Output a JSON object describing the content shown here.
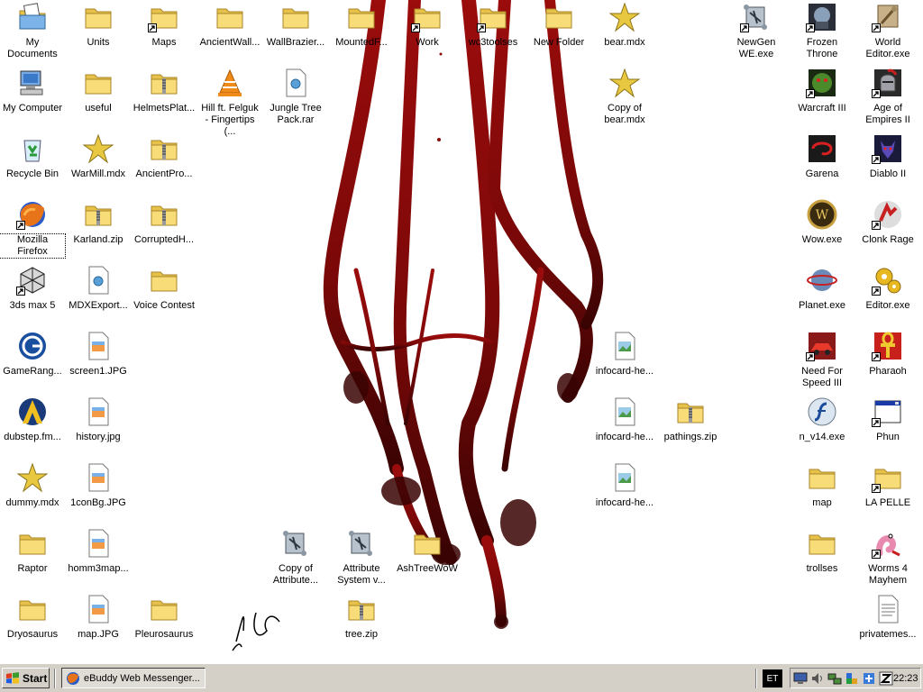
{
  "desktop": {
    "icons": [
      {
        "id": "my-documents",
        "label": "My Documents",
        "type": "mydocs",
        "shortcut": false,
        "col": 0,
        "row": 0
      },
      {
        "id": "units",
        "label": "Units",
        "type": "folder",
        "shortcut": false,
        "col": 1,
        "row": 0
      },
      {
        "id": "maps",
        "label": "Maps",
        "type": "folder",
        "shortcut": true,
        "col": 2,
        "row": 0
      },
      {
        "id": "ancientwall",
        "label": "AncientWall...",
        "type": "folder",
        "shortcut": false,
        "col": 3,
        "row": 0
      },
      {
        "id": "wallbrazier",
        "label": "WallBrazier...",
        "type": "folder",
        "shortcut": false,
        "col": 4,
        "row": 0
      },
      {
        "id": "mountedf",
        "label": "MountedF...",
        "type": "folder",
        "shortcut": false,
        "col": 5,
        "row": 0
      },
      {
        "id": "work",
        "label": "Work",
        "type": "folder",
        "shortcut": true,
        "col": 6,
        "row": 0
      },
      {
        "id": "wc3toolses",
        "label": "wc3toolses",
        "type": "folder",
        "shortcut": true,
        "col": 7,
        "row": 0
      },
      {
        "id": "new-folder",
        "label": "New Folder",
        "type": "folder",
        "shortcut": false,
        "col": 8,
        "row": 0
      },
      {
        "id": "bear-mdx",
        "label": "bear.mdx",
        "type": "star",
        "shortcut": false,
        "col": 9,
        "row": 0
      },
      {
        "id": "newgen-we",
        "label": "NewGen WE.exe",
        "type": "scroll",
        "shortcut": true,
        "col": 11,
        "row": 0
      },
      {
        "id": "frozen-throne",
        "label": "Frozen Throne",
        "type": "frozen",
        "shortcut": true,
        "col": 12,
        "row": 0
      },
      {
        "id": "world-editor",
        "label": "World Editor.exe",
        "type": "worldeditor",
        "shortcut": true,
        "col": 13,
        "row": 0
      },
      {
        "id": "my-computer",
        "label": "My Computer",
        "type": "computer",
        "shortcut": false,
        "col": 0,
        "row": 1
      },
      {
        "id": "useful",
        "label": "useful",
        "type": "folder",
        "shortcut": false,
        "col": 1,
        "row": 1
      },
      {
        "id": "helmetsplat",
        "label": "HelmetsPlat...",
        "type": "zip",
        "shortcut": false,
        "col": 2,
        "row": 1
      },
      {
        "id": "hill-felguk",
        "label": "Hill ft. Felguk - Fingertips (...",
        "type": "vlc",
        "shortcut": false,
        "col": 3,
        "row": 1
      },
      {
        "id": "jungle-tree",
        "label": "Jungle Tree Pack.rar",
        "type": "doc",
        "shortcut": false,
        "col": 4,
        "row": 1
      },
      {
        "id": "copy-bear",
        "label": "Copy of bear.mdx",
        "type": "star",
        "shortcut": false,
        "col": 9,
        "row": 1
      },
      {
        "id": "warcraft3",
        "label": "Warcraft III",
        "type": "orc",
        "shortcut": true,
        "col": 12,
        "row": 1
      },
      {
        "id": "aoe2",
        "label": "Age of Empires II",
        "type": "knight",
        "shortcut": true,
        "col": 13,
        "row": 1
      },
      {
        "id": "recycle-bin",
        "label": "Recycle Bin",
        "type": "recycle",
        "shortcut": false,
        "col": 0,
        "row": 2
      },
      {
        "id": "warmill",
        "label": "WarMill.mdx",
        "type": "star",
        "shortcut": false,
        "col": 1,
        "row": 2
      },
      {
        "id": "ancientpro",
        "label": "AncientPro...",
        "type": "zip",
        "shortcut": false,
        "col": 2,
        "row": 2
      },
      {
        "id": "garena",
        "label": "Garena",
        "type": "garena",
        "shortcut": false,
        "col": 12,
        "row": 2
      },
      {
        "id": "diablo2",
        "label": "Diablo II",
        "type": "diablo",
        "shortcut": true,
        "col": 13,
        "row": 2
      },
      {
        "id": "firefox",
        "label": "Mozilla Firefox",
        "type": "firefox",
        "shortcut": true,
        "col": 0,
        "row": 3,
        "selected": true
      },
      {
        "id": "karland",
        "label": "Karland.zip",
        "type": "zip",
        "shortcut": false,
        "col": 1,
        "row": 3
      },
      {
        "id": "corruptedh",
        "label": "CorruptedH...",
        "type": "zip",
        "shortcut": false,
        "col": 2,
        "row": 3
      },
      {
        "id": "wow",
        "label": "Wow.exe",
        "type": "wow",
        "shortcut": false,
        "col": 12,
        "row": 3
      },
      {
        "id": "clonk",
        "label": "Clonk Rage",
        "type": "clonk",
        "shortcut": true,
        "col": 13,
        "row": 3
      },
      {
        "id": "3dsmax",
        "label": "3ds max 5",
        "type": "max",
        "shortcut": true,
        "col": 0,
        "row": 4
      },
      {
        "id": "mdxexport",
        "label": "MDXExport...",
        "type": "doc",
        "shortcut": false,
        "col": 1,
        "row": 4
      },
      {
        "id": "voice-contest",
        "label": "Voice Contest",
        "type": "folder",
        "shortcut": false,
        "col": 2,
        "row": 4
      },
      {
        "id": "planet",
        "label": "Planet.exe",
        "type": "planet",
        "shortcut": false,
        "col": 12,
        "row": 4
      },
      {
        "id": "editor",
        "label": "Editor.exe",
        "type": "gears",
        "shortcut": true,
        "col": 13,
        "row": 4
      },
      {
        "id": "gameranger",
        "label": "GameRang...",
        "type": "gameranger",
        "shortcut": false,
        "col": 0,
        "row": 5
      },
      {
        "id": "screen1",
        "label": "screen1.JPG",
        "type": "jpg",
        "shortcut": false,
        "col": 1,
        "row": 5
      },
      {
        "id": "infocard1",
        "label": "infocard-he...",
        "type": "image",
        "shortcut": false,
        "col": 9,
        "row": 5
      },
      {
        "id": "nfs3",
        "label": "Need For Speed III",
        "type": "nfs",
        "shortcut": true,
        "col": 12,
        "row": 5
      },
      {
        "id": "pharaoh",
        "label": "Pharaoh",
        "type": "ankh",
        "shortcut": true,
        "col": 13,
        "row": 5
      },
      {
        "id": "dubstep",
        "label": "dubstep.fm...",
        "type": "dubstep",
        "shortcut": false,
        "col": 0,
        "row": 6
      },
      {
        "id": "history",
        "label": "history.jpg",
        "type": "jpg",
        "shortcut": false,
        "col": 1,
        "row": 6
      },
      {
        "id": "infocard2",
        "label": "infocard-he...",
        "type": "image",
        "shortcut": false,
        "col": 9,
        "row": 6
      },
      {
        "id": "pathings",
        "label": "pathings.zip",
        "type": "zip",
        "shortcut": false,
        "col": 10,
        "row": 6
      },
      {
        "id": "n-v14",
        "label": "n_v14.exe",
        "type": "flash",
        "shortcut": false,
        "col": 12,
        "row": 6
      },
      {
        "id": "phun",
        "label": "Phun",
        "type": "window",
        "shortcut": true,
        "col": 13,
        "row": 6
      },
      {
        "id": "dummy",
        "label": "dummy.mdx",
        "type": "star",
        "shortcut": false,
        "col": 0,
        "row": 7
      },
      {
        "id": "iconbg",
        "label": "1conBg.JPG",
        "type": "jpg",
        "shortcut": false,
        "col": 1,
        "row": 7
      },
      {
        "id": "infocard3",
        "label": "infocard-he...",
        "type": "image",
        "shortcut": false,
        "col": 9,
        "row": 7
      },
      {
        "id": "map-folder",
        "label": "map",
        "type": "folder",
        "shortcut": false,
        "col": 12,
        "row": 7
      },
      {
        "id": "la-pelle",
        "label": "LA PELLE",
        "type": "folder",
        "shortcut": true,
        "col": 13,
        "row": 7
      },
      {
        "id": "raptor",
        "label": "Raptor",
        "type": "folder",
        "shortcut": false,
        "col": 0,
        "row": 8
      },
      {
        "id": "homm3map",
        "label": "homm3map...",
        "type": "jpg",
        "shortcut": false,
        "col": 1,
        "row": 8
      },
      {
        "id": "copy-attribute",
        "label": "Copy of Attribute...",
        "type": "scroll",
        "shortcut": false,
        "col": 4,
        "row": 8
      },
      {
        "id": "attribute-system",
        "label": "Attribute System v...",
        "type": "scroll",
        "shortcut": false,
        "col": 5,
        "row": 8
      },
      {
        "id": "ashtree",
        "label": "AshTreeWoW",
        "type": "folder",
        "shortcut": false,
        "col": 6,
        "row": 8
      },
      {
        "id": "trollses",
        "label": "trollses",
        "type": "folder",
        "shortcut": false,
        "col": 12,
        "row": 8
      },
      {
        "id": "worms4",
        "label": "Worms 4 Mayhem",
        "type": "worms",
        "shortcut": true,
        "col": 13,
        "row": 8
      },
      {
        "id": "dryosaurus",
        "label": "Dryosaurus",
        "type": "folder",
        "shortcut": false,
        "col": 0,
        "row": 9
      },
      {
        "id": "map-jpg",
        "label": "map.JPG",
        "type": "jpg",
        "shortcut": false,
        "col": 1,
        "row": 9
      },
      {
        "id": "pleurosaurus",
        "label": "Pleurosaurus",
        "type": "folder",
        "shortcut": false,
        "col": 2,
        "row": 9
      },
      {
        "id": "tree-zip",
        "label": "tree.zip",
        "type": "zip",
        "shortcut": false,
        "col": 5,
        "row": 9
      },
      {
        "id": "privatemes",
        "label": "privatemes...",
        "type": "textfile",
        "shortcut": false,
        "col": 13,
        "row": 9
      }
    ]
  },
  "taskbar": {
    "start_label": "Start",
    "tasks": [
      {
        "label": "eBuddy Web Messenger..."
      }
    ],
    "language": "ET",
    "clock": "22:23",
    "tray_icons": [
      "display-icon",
      "speaker-icon",
      "network-icon",
      "app-icon",
      "security-icon",
      "zone-alarm-icon"
    ]
  },
  "colors": {
    "taskbar": "#d4d0c8",
    "wallpaper_blood": "#8b0a0a",
    "desktop_background": "#ffffff"
  }
}
